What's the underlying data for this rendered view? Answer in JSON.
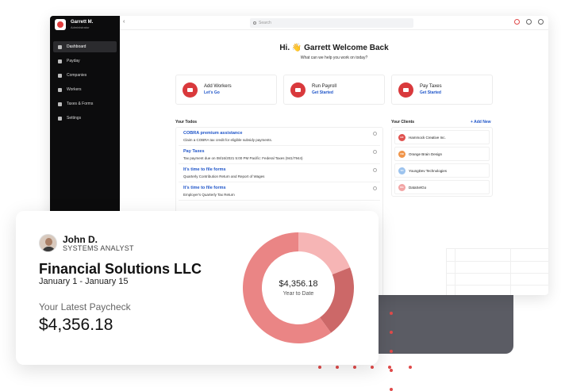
{
  "sidebar": {
    "user_name": "Garrett M.",
    "user_role": "Administrator",
    "items": [
      {
        "label": "Dashboard"
      },
      {
        "label": "Payday"
      },
      {
        "label": "Companies"
      },
      {
        "label": "Workers"
      },
      {
        "label": "Taxes & Forms"
      },
      {
        "label": "Settings"
      }
    ]
  },
  "topbar": {
    "search_placeholder": "Search"
  },
  "main": {
    "welcome": "Hi. 👋 Garrett Welcome Back",
    "welcome_sub": "What can we help you work on today?",
    "actions": [
      {
        "title": "Add Workers",
        "link": "Let's Go"
      },
      {
        "title": "Run Payroll",
        "link": "Get Started"
      },
      {
        "title": "Pay Taxes",
        "link": "Get Started"
      }
    ],
    "todos_title": "Your Todos",
    "todos": [
      {
        "title": "COBRA premium assistance",
        "desc": "Claim a COBRA tax credit for eligible subsidy payments."
      },
      {
        "title": "Pay Taxes",
        "desc": "Tax payment due on 08/16/2021 5:00 PM Pacific: Federal Taxes (941/7944)"
      },
      {
        "title": "It's time to file forms",
        "desc": "Quarterly Contribution Return and Report of Wages"
      },
      {
        "title": "It's time to file forms",
        "desc": "Employer's Quarterly Tax Return"
      }
    ],
    "clients_title": "Your Clients",
    "clients_add": "+ Add New",
    "clients": [
      {
        "initials": "HC",
        "name": "Hammock Creative Inc.",
        "color": "#e0524f"
      },
      {
        "initials": "OB",
        "name": "Orange Brain Design",
        "color": "#f0954a"
      },
      {
        "initials": "YD",
        "name": "YoungDev Technologies",
        "color": "#9cc3ee"
      },
      {
        "initials": "DG",
        "name": "DataSetGo",
        "color": "#f2a5a5"
      }
    ]
  },
  "paycheck": {
    "name": "John D.",
    "role": "SYSTEMS ANALYST",
    "company": "Financial Solutions LLC",
    "dates": "January 1 - January 15",
    "label": "Your Latest Paycheck",
    "amount": "$4,356.18",
    "donut_amount": "$4,356.18",
    "donut_label": "Year to Date",
    "donut_colors": [
      "#f6b5b5",
      "#cc6868",
      "#ea8585"
    ],
    "donut_shares": [
      0.19,
      0.21,
      0.6
    ]
  }
}
